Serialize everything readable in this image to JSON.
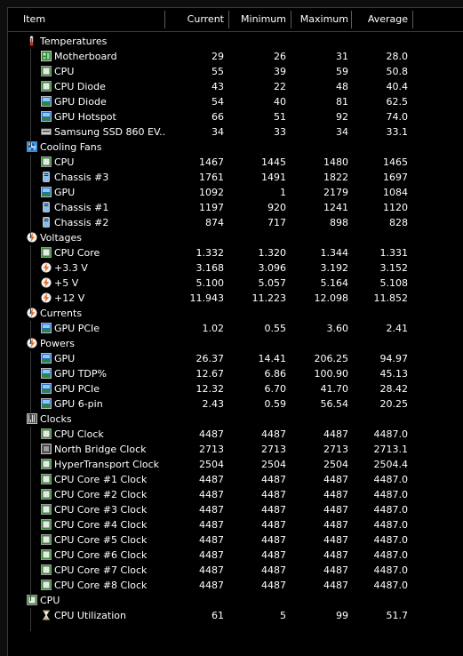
{
  "header": {
    "item": "Item",
    "current": "Current",
    "minimum": "Minimum",
    "maximum": "Maximum",
    "average": "Average"
  },
  "rows": [
    {
      "kind": "group",
      "icon": "thermometer-icon",
      "label": "Temperatures"
    },
    {
      "kind": "item",
      "icon": "motherboard-icon",
      "label": "Motherboard",
      "cur": "29",
      "min": "26",
      "max": "31",
      "avg": "28.0"
    },
    {
      "kind": "item",
      "icon": "chip-icon",
      "label": "CPU",
      "cur": "55",
      "min": "39",
      "max": "59",
      "avg": "50.8"
    },
    {
      "kind": "item",
      "icon": "chip-icon",
      "label": "CPU Diode",
      "cur": "43",
      "min": "22",
      "max": "48",
      "avg": "40.4"
    },
    {
      "kind": "item",
      "icon": "gpu-icon",
      "label": "GPU Diode",
      "cur": "54",
      "min": "40",
      "max": "81",
      "avg": "62.5"
    },
    {
      "kind": "item",
      "icon": "gpu-icon",
      "label": "GPU Hotspot",
      "cur": "66",
      "min": "51",
      "max": "92",
      "avg": "74.0"
    },
    {
      "kind": "item",
      "icon": "drive-icon",
      "label": "Samsung SSD 860 EV...",
      "cur": "34",
      "min": "33",
      "max": "34",
      "avg": "33.1"
    },
    {
      "kind": "group",
      "icon": "fan-icon",
      "label": "Cooling Fans"
    },
    {
      "kind": "item",
      "icon": "chip-icon",
      "label": "CPU",
      "cur": "1467",
      "min": "1445",
      "max": "1480",
      "avg": "1465"
    },
    {
      "kind": "item",
      "icon": "chassis-icon",
      "label": "Chassis #3",
      "cur": "1761",
      "min": "1491",
      "max": "1822",
      "avg": "1697"
    },
    {
      "kind": "item",
      "icon": "gpu-icon",
      "label": "GPU",
      "cur": "1092",
      "min": "1",
      "max": "2179",
      "avg": "1084"
    },
    {
      "kind": "item",
      "icon": "chassis-icon",
      "label": "Chassis #1",
      "cur": "1197",
      "min": "920",
      "max": "1241",
      "avg": "1120"
    },
    {
      "kind": "item",
      "icon": "chassis-icon",
      "label": "Chassis #2",
      "cur": "874",
      "min": "717",
      "max": "898",
      "avg": "828"
    },
    {
      "kind": "group",
      "icon": "lightning-icon",
      "label": "Voltages"
    },
    {
      "kind": "item",
      "icon": "chip-icon",
      "label": "CPU Core",
      "cur": "1.332",
      "min": "1.320",
      "max": "1.344",
      "avg": "1.331"
    },
    {
      "kind": "item",
      "icon": "lightning-icon",
      "label": "+3.3 V",
      "cur": "3.168",
      "min": "3.096",
      "max": "3.192",
      "avg": "3.152"
    },
    {
      "kind": "item",
      "icon": "lightning-icon",
      "label": "+5 V",
      "cur": "5.100",
      "min": "5.057",
      "max": "5.164",
      "avg": "5.108"
    },
    {
      "kind": "item",
      "icon": "lightning-icon",
      "label": "+12 V",
      "cur": "11.943",
      "min": "11.223",
      "max": "12.098",
      "avg": "11.852"
    },
    {
      "kind": "group",
      "icon": "lightning-icon",
      "label": "Currents"
    },
    {
      "kind": "item",
      "icon": "gpu-icon",
      "label": "GPU PCIe",
      "cur": "1.02",
      "min": "0.55",
      "max": "3.60",
      "avg": "2.41"
    },
    {
      "kind": "group",
      "icon": "lightning-icon",
      "label": "Powers"
    },
    {
      "kind": "item",
      "icon": "gpu-icon",
      "label": "GPU",
      "cur": "26.37",
      "min": "14.41",
      "max": "206.25",
      "avg": "94.97"
    },
    {
      "kind": "item",
      "icon": "gpu-icon",
      "label": "GPU TDP%",
      "cur": "12.67",
      "min": "6.86",
      "max": "100.90",
      "avg": "45.13"
    },
    {
      "kind": "item",
      "icon": "gpu-icon",
      "label": "GPU PCIe",
      "cur": "12.32",
      "min": "6.70",
      "max": "41.70",
      "avg": "28.42"
    },
    {
      "kind": "item",
      "icon": "gpu-icon",
      "label": "GPU 6-pin",
      "cur": "2.43",
      "min": "0.59",
      "max": "56.54",
      "avg": "20.25"
    },
    {
      "kind": "group",
      "icon": "clock-icon",
      "label": "Clocks"
    },
    {
      "kind": "item",
      "icon": "chip-icon",
      "label": "CPU Clock",
      "cur": "4487",
      "min": "4487",
      "max": "4487",
      "avg": "4487.0"
    },
    {
      "kind": "item",
      "icon": "northbridge-icon",
      "label": "North Bridge Clock",
      "cur": "2713",
      "min": "2713",
      "max": "2713",
      "avg": "2713.1"
    },
    {
      "kind": "item",
      "icon": "chip-icon",
      "label": "HyperTransport Clock",
      "cur": "2504",
      "min": "2504",
      "max": "2504",
      "avg": "2504.4"
    },
    {
      "kind": "item",
      "icon": "chip-icon",
      "label": "CPU Core #1 Clock",
      "cur": "4487",
      "min": "4487",
      "max": "4487",
      "avg": "4487.0"
    },
    {
      "kind": "item",
      "icon": "chip-icon",
      "label": "CPU Core #2 Clock",
      "cur": "4487",
      "min": "4487",
      "max": "4487",
      "avg": "4487.0"
    },
    {
      "kind": "item",
      "icon": "chip-icon",
      "label": "CPU Core #3 Clock",
      "cur": "4487",
      "min": "4487",
      "max": "4487",
      "avg": "4487.0"
    },
    {
      "kind": "item",
      "icon": "chip-icon",
      "label": "CPU Core #4 Clock",
      "cur": "4487",
      "min": "4487",
      "max": "4487",
      "avg": "4487.0"
    },
    {
      "kind": "item",
      "icon": "chip-icon",
      "label": "CPU Core #5 Clock",
      "cur": "4487",
      "min": "4487",
      "max": "4487",
      "avg": "4487.0"
    },
    {
      "kind": "item",
      "icon": "chip-icon",
      "label": "CPU Core #6 Clock",
      "cur": "4487",
      "min": "4487",
      "max": "4487",
      "avg": "4487.0"
    },
    {
      "kind": "item",
      "icon": "chip-icon",
      "label": "CPU Core #7 Clock",
      "cur": "4487",
      "min": "4487",
      "max": "4487",
      "avg": "4487.0"
    },
    {
      "kind": "item",
      "icon": "chip-icon",
      "label": "CPU Core #8 Clock",
      "cur": "4487",
      "min": "4487",
      "max": "4487",
      "avg": "4487.0"
    },
    {
      "kind": "group",
      "icon": "chip-icon",
      "label": "CPU"
    },
    {
      "kind": "item",
      "icon": "hourglass-icon",
      "label": "CPU Utilization",
      "cur": "61",
      "min": "5",
      "max": "99",
      "avg": "51.7"
    }
  ]
}
